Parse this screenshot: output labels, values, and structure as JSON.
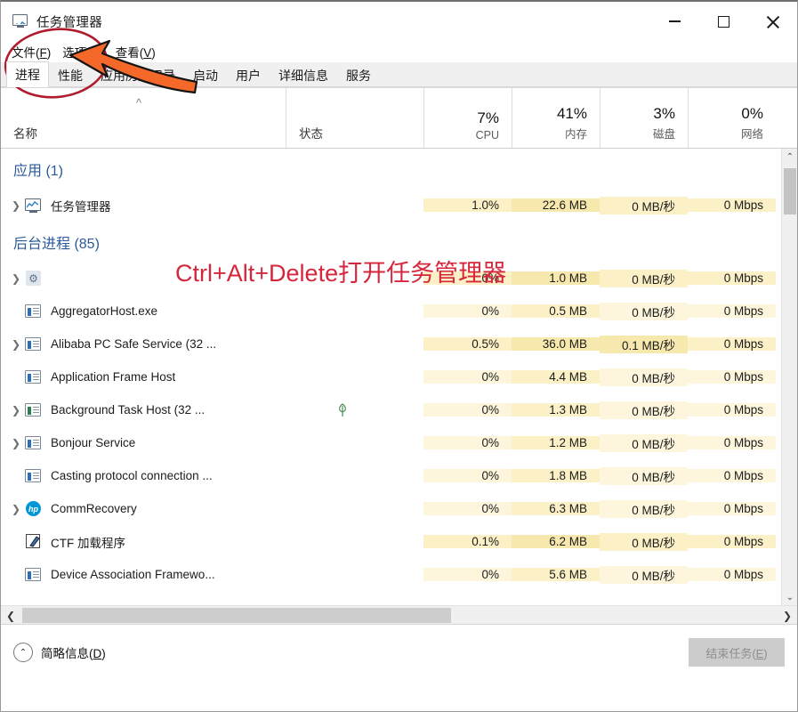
{
  "window": {
    "title": "任务管理器",
    "icon": "task-manager-icon",
    "minimize_label": "—",
    "maximize_label": "□",
    "close_label": "✕"
  },
  "menu": [
    {
      "label": "文件(F)",
      "text": "文件",
      "accel": "F"
    },
    {
      "label": "选项(O)",
      "text": "选项",
      "accel": "O"
    },
    {
      "label": "查看(V)",
      "text": "查看",
      "accel": "V"
    }
  ],
  "tabs": [
    {
      "label": "进程",
      "active": true
    },
    {
      "label": "性能",
      "active": false
    },
    {
      "label": "应用历史记录",
      "active": false
    },
    {
      "label": "启动",
      "active": false
    },
    {
      "label": "用户",
      "active": false
    },
    {
      "label": "详细信息",
      "active": false
    },
    {
      "label": "服务",
      "active": false
    }
  ],
  "columns": {
    "name": {
      "label": "名称",
      "sort": "ascending",
      "sort_glyph": "^"
    },
    "status": {
      "label": "状态"
    },
    "cpu": {
      "pct": "7%",
      "label": "CPU"
    },
    "memory": {
      "pct": "41%",
      "label": "内存"
    },
    "disk": {
      "pct": "3%",
      "label": "磁盘"
    },
    "network": {
      "pct": "0%",
      "label": "网络"
    }
  },
  "groups": [
    {
      "label": "应用 (1)"
    },
    {
      "label": "后台进程 (85)"
    }
  ],
  "rows": [
    {
      "kind": "group",
      "group_index": 0,
      "label": "应用 (1)"
    },
    {
      "kind": "process",
      "expandable": true,
      "icon": "task-manager-icon",
      "name": "任务管理器",
      "status": "",
      "cpu": "1.0%",
      "memory": "22.6 MB",
      "disk": "0 MB/秒",
      "network": "0 Mbps",
      "shade": {
        "cpu": "h2",
        "memory": "h3",
        "disk": "h2",
        "network": "h2"
      }
    },
    {
      "kind": "group",
      "group_index": 1,
      "label": "后台进程 (85)"
    },
    {
      "kind": "process",
      "expandable": true,
      "icon": "gear-icon",
      "name": "",
      "status": "",
      "cpu": "0%",
      "memory": "1.0 MB",
      "disk": "0 MB/秒",
      "network": "0 Mbps",
      "shade": {
        "cpu": "h2",
        "memory": "h3",
        "disk": "h2",
        "network": "h2"
      }
    },
    {
      "kind": "process",
      "expandable": false,
      "icon": "window-icon",
      "name": "AggregatorHost.exe",
      "status": "",
      "cpu": "0%",
      "memory": "0.5 MB",
      "disk": "0 MB/秒",
      "network": "0 Mbps",
      "shade": {
        "cpu": "h1",
        "memory": "h2",
        "disk": "h1",
        "network": "h1"
      }
    },
    {
      "kind": "process",
      "expandable": true,
      "icon": "window-icon",
      "name": "Alibaba PC Safe Service (32 ...",
      "status": "",
      "cpu": "0.5%",
      "memory": "36.0 MB",
      "disk": "0.1 MB/秒",
      "network": "0 Mbps",
      "shade": {
        "cpu": "h2",
        "memory": "h3",
        "disk": "h3",
        "network": "h2"
      }
    },
    {
      "kind": "process",
      "expandable": false,
      "icon": "window-icon",
      "name": "Application Frame Host",
      "status": "",
      "cpu": "0%",
      "memory": "4.4 MB",
      "disk": "0 MB/秒",
      "network": "0 Mbps",
      "shade": {
        "cpu": "h1",
        "memory": "h2",
        "disk": "h1",
        "network": "h1"
      }
    },
    {
      "kind": "process",
      "expandable": true,
      "icon": "window-green-icon",
      "name": "Background Task Host (32 ...",
      "status": "leaf-icon",
      "cpu": "0%",
      "memory": "1.3 MB",
      "disk": "0 MB/秒",
      "network": "0 Mbps",
      "shade": {
        "cpu": "h1",
        "memory": "h2",
        "disk": "h1",
        "network": "h1"
      }
    },
    {
      "kind": "process",
      "expandable": true,
      "icon": "window-icon",
      "name": "Bonjour Service",
      "status": "",
      "cpu": "0%",
      "memory": "1.2 MB",
      "disk": "0 MB/秒",
      "network": "0 Mbps",
      "shade": {
        "cpu": "h1",
        "memory": "h2",
        "disk": "h1",
        "network": "h1"
      }
    },
    {
      "kind": "process",
      "expandable": false,
      "icon": "window-icon",
      "name": "Casting protocol connection ...",
      "status": "",
      "cpu": "0%",
      "memory": "1.8 MB",
      "disk": "0 MB/秒",
      "network": "0 Mbps",
      "shade": {
        "cpu": "h1",
        "memory": "h2",
        "disk": "h1",
        "network": "h1"
      }
    },
    {
      "kind": "process",
      "expandable": true,
      "icon": "hp-icon",
      "name": "CommRecovery",
      "status": "",
      "cpu": "0%",
      "memory": "6.3 MB",
      "disk": "0 MB/秒",
      "network": "0 Mbps",
      "shade": {
        "cpu": "h1",
        "memory": "h2",
        "disk": "h1",
        "network": "h1"
      }
    },
    {
      "kind": "process",
      "expandable": false,
      "icon": "ctf-loader-icon",
      "name": "CTF 加载程序",
      "status": "",
      "cpu": "0.1%",
      "memory": "6.2 MB",
      "disk": "0 MB/秒",
      "network": "0 Mbps",
      "shade": {
        "cpu": "h2",
        "memory": "h3",
        "disk": "h2",
        "network": "h2"
      }
    },
    {
      "kind": "process",
      "expandable": false,
      "icon": "window-icon",
      "name": "Device Association Framewo...",
      "status": "",
      "cpu": "0%",
      "memory": "5.6 MB",
      "disk": "0 MB/秒",
      "network": "0 Mbps",
      "shade": {
        "cpu": "h1",
        "memory": "h2",
        "disk": "h1",
        "network": "h1"
      }
    }
  ],
  "scrollbars": {
    "vertical": {
      "up_glyph": "⌃",
      "down_glyph": "⌄"
    },
    "horizontal": {
      "left_glyph": "❮",
      "right_glyph": "❯"
    }
  },
  "statusbar": {
    "fewer_details": {
      "text": "简略信息",
      "accel": "D",
      "chevron": "⌃"
    },
    "end_task": {
      "text": "结束任务",
      "accel": "E",
      "disabled": true
    }
  },
  "annotations": {
    "callout_text": "Ctrl+Alt+Delete打开任务管理器",
    "callout_color": "#d6263c",
    "circle_color": "#b01b2e",
    "arrow_color": "#f4682a"
  }
}
